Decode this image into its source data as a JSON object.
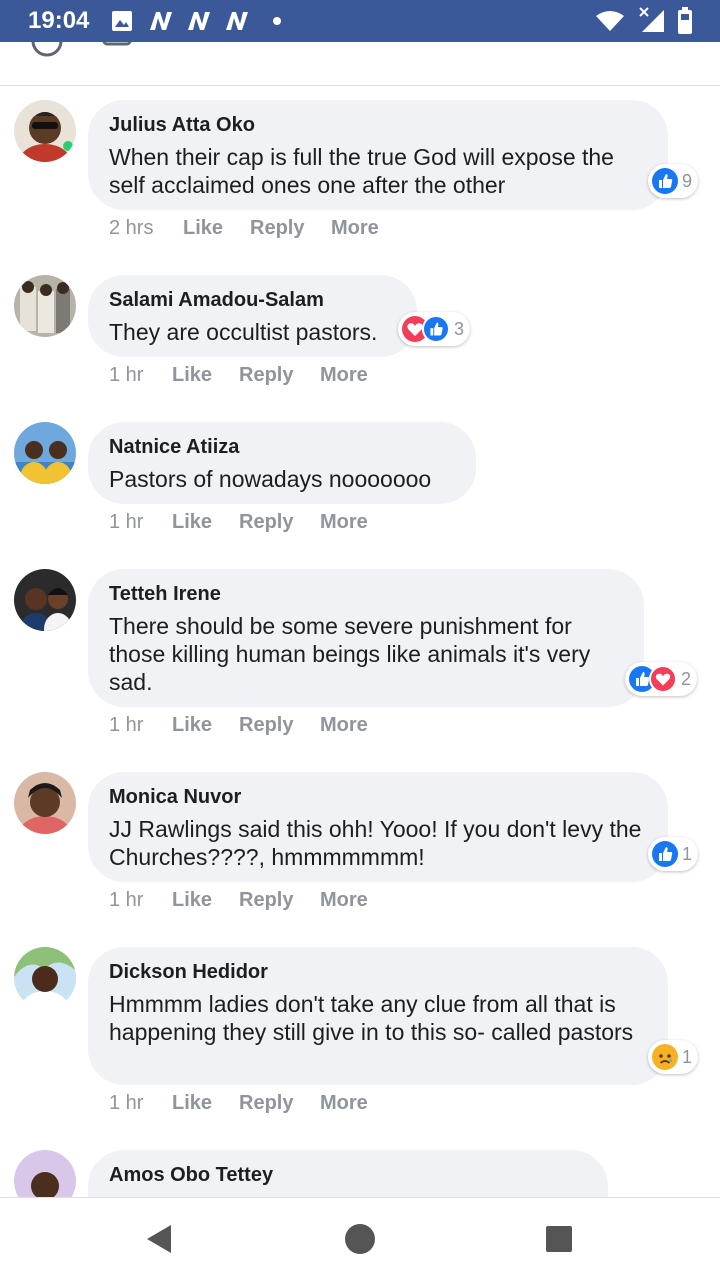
{
  "status_bar": {
    "time": "19:04"
  },
  "comments": [
    {
      "author": "Julius Atta Oko",
      "text": "When their cap is full the true God will expose the self acclaimed ones one after the other",
      "time": "2 hrs",
      "like": "Like",
      "reply": "Reply",
      "more": "More",
      "reactions": [
        "like"
      ],
      "reaction_count": "9"
    },
    {
      "author": "Salami Amadou-Salam",
      "text": "They are occultist pastors.",
      "time": "1 hr",
      "like": "Like",
      "reply": "Reply",
      "more": "More",
      "reactions": [
        "love",
        "like"
      ],
      "reaction_count": "3"
    },
    {
      "author": "Natnice Atiiza",
      "text": "Pastors of nowadays nooooooo",
      "time": "1 hr",
      "like": "Like",
      "reply": "Reply",
      "more": "More"
    },
    {
      "author": "Tetteh Irene",
      "text": "There should be some severe punishment for those killing human beings like animals it's very sad.",
      "time": "1 hr",
      "like": "Like",
      "reply": "Reply",
      "more": "More",
      "reactions": [
        "like",
        "love"
      ],
      "reaction_count": "2"
    },
    {
      "author": "Monica Nuvor",
      "text": "JJ Rawlings said this ohh! Yooo! If you don't levy the Churches????, hmmmmmmm!",
      "time": "1 hr",
      "like": "Like",
      "reply": "Reply",
      "more": "More",
      "reactions": [
        "like"
      ],
      "reaction_count": "1"
    },
    {
      "author": "Dickson Hedidor",
      "text": "Hmmmm ladies don't take any clue from all that is happening they still give in to this so- called pastors",
      "time": "1 hr",
      "like": "Like",
      "reply": "Reply",
      "more": "More",
      "reactions": [
        "sad"
      ],
      "reaction_count": "1"
    },
    {
      "author": "Amos Obo Tettey"
    }
  ],
  "nav": {
    "back": "back-icon",
    "home": "home-icon",
    "recents": "recents-icon"
  }
}
